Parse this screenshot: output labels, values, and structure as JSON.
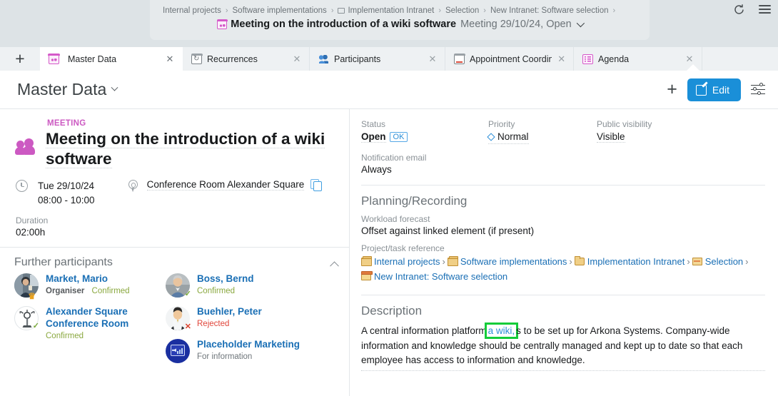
{
  "window": {
    "refresh_icon": "refresh-icon",
    "menu_icon": "hamburger-menu-icon"
  },
  "breadcrumb": {
    "items": [
      {
        "label": "Internal projects",
        "icon": null
      },
      {
        "label": "Software implementations",
        "icon": null
      },
      {
        "label": "Implementation Intranet",
        "icon": "folder-outline-icon"
      },
      {
        "label": "Selection",
        "icon": null
      },
      {
        "label": "New Intranet: Software selection",
        "icon": null
      }
    ],
    "separator": "›",
    "entity_icon": "meeting-icon",
    "title": "Meeting on the introduction of a wiki software",
    "subtitle": "Meeting 29/10/24, Open",
    "dropdown_icon": "chevron-down-icon"
  },
  "tabs": {
    "add_label": "+",
    "close_label": "✕",
    "items": [
      {
        "label": "Master Data",
        "icon": "meeting-icon",
        "active": true
      },
      {
        "label": "Recurrences",
        "icon": "recurrence-calendar-icon",
        "active": false
      },
      {
        "label": "Participants",
        "icon": "participants-people-icon",
        "active": false
      },
      {
        "label": "Appointment Coordinat",
        "icon": "appointment-calendar-icon",
        "active": false
      },
      {
        "label": "Agenda",
        "icon": "agenda-list-icon",
        "active": false
      }
    ]
  },
  "page_header": {
    "title": "Master Data",
    "dropdown_icon": "chevron-down-icon",
    "add_icon": "plus-icon",
    "edit_label": "Edit",
    "edit_icon": "pencil-icon",
    "settings_icon": "sliders-icon"
  },
  "summary": {
    "kicker": "MEETING",
    "icon": "meeting-people-icon",
    "title": "Meeting on the introduction of a wiki software",
    "date_icon": "clock-icon",
    "date": "Tue 29/10/24",
    "time": "08:00 - 10:00",
    "location_icon": "map-pin-icon",
    "location": "Conference Room Alexander Square",
    "copy_icon": "copy-icon",
    "duration_label": "Duration",
    "duration_value": "02:00h"
  },
  "participants": {
    "heading": "Further participants",
    "collapse_icon": "chevron-up-icon",
    "left_column": [
      {
        "name": "Market, Mario",
        "role": "Organiser",
        "status": "Confirmed",
        "status_kind": "confirmed",
        "badge": "crown",
        "avatar": "photo-avatar"
      },
      {
        "name": "Alexander Square Conference Room",
        "role": "",
        "status": "Confirmed",
        "status_kind": "confirmed",
        "badge": "check",
        "avatar": "tv-tower-icon"
      }
    ],
    "right_column": [
      {
        "name": "Boss, Bernd",
        "role": "",
        "status": "Confirmed",
        "status_kind": "confirmed",
        "badge": "check",
        "avatar": "photo-avatar"
      },
      {
        "name": "Buehler, Peter",
        "role": "",
        "status": "Rejected",
        "status_kind": "rejected",
        "badge": "cross",
        "avatar": "photo-avatar"
      },
      {
        "name": "Placeholder Marketing",
        "role": "",
        "status": "For information",
        "status_kind": "info",
        "badge": "",
        "avatar": "marketing-placeholder-icon"
      }
    ]
  },
  "details": {
    "status_label": "Status",
    "status_value": "Open",
    "status_chip": "OK",
    "priority_label": "Priority",
    "priority_value": "Normal",
    "priority_icon": "diamond-icon",
    "visibility_label": "Public visibility",
    "visibility_value": "Visible",
    "notification_label": "Notification email",
    "notification_value": "Always"
  },
  "planning": {
    "heading": "Planning/Recording",
    "workload_label": "Workload forecast",
    "workload_value": "Offset against linked element (if present)",
    "reference_label": "Project/task reference",
    "reference_separator": "›",
    "reference_path": [
      {
        "label": "Internal projects",
        "icon": "folder-stack-icon"
      },
      {
        "label": "Software implementations",
        "icon": "folder-stack-icon"
      },
      {
        "label": "Implementation Intranet",
        "icon": "folder-icon"
      },
      {
        "label": "Selection",
        "icon": "folder-open-icon"
      },
      {
        "label": "New Intranet: Software selection",
        "icon": "document-folder-icon"
      }
    ]
  },
  "description": {
    "heading": "Description",
    "text_before": "A central information platform",
    "link_text": "a wiki,",
    "text_after": "s to be set up for Arkona Systems. Company-wide information and knowledge should be centrally managed and kept up to date so that each employee has access to information and knowledge.",
    "highlight_color": "#14cc3a"
  },
  "colors": {
    "accent_blue": "#1a8fd8",
    "link_blue": "#1a6fb5",
    "meeting_pink": "#cc59c2",
    "confirmed_green": "#8aa83f",
    "rejected_red": "#e0453a",
    "topbar_bg": "#dde3e6"
  }
}
